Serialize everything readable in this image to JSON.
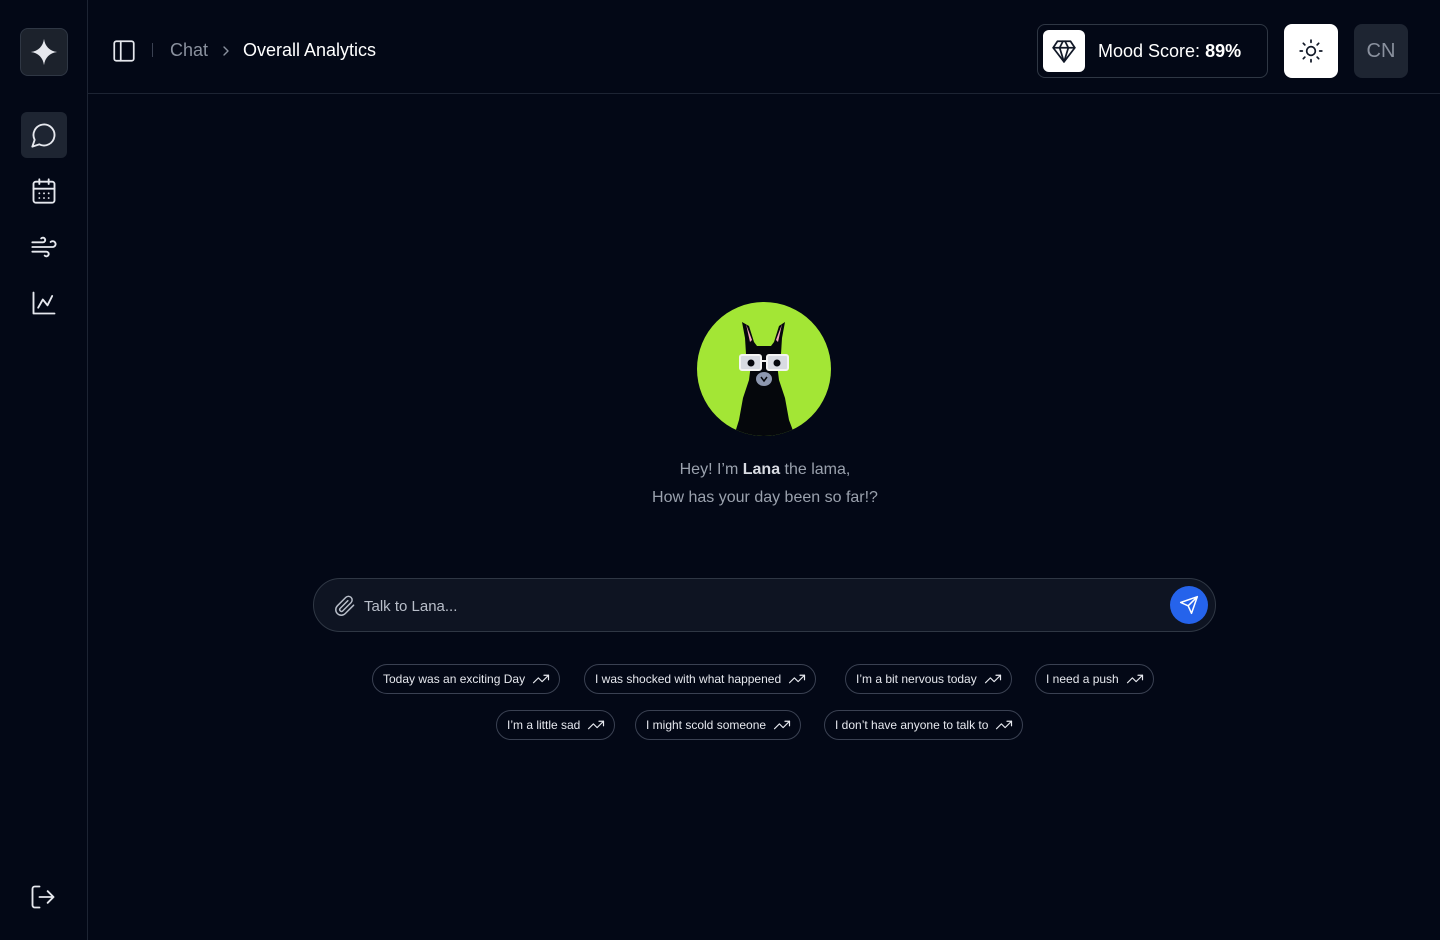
{
  "sidebar": {
    "logo_icon": "sparkle-icon",
    "nav": [
      {
        "icon": "chat-bubble-icon",
        "active": true
      },
      {
        "icon": "calendar-icon",
        "active": false
      },
      {
        "icon": "wind-icon",
        "active": false
      },
      {
        "icon": "chart-icon",
        "active": false
      }
    ],
    "logout_icon": "logout-icon"
  },
  "header": {
    "breadcrumb": {
      "parent": "Chat",
      "current": "Overall Analytics"
    },
    "mood": {
      "label": "Mood Score: ",
      "value": "89%"
    },
    "theme_icon": "sun-icon",
    "avatar": "CN"
  },
  "main": {
    "greeting": {
      "prefix": "Hey! I’m ",
      "name": "Lana",
      "suffix": " the lama,",
      "question": "How has your day been so far!?"
    },
    "input": {
      "placeholder": "Talk to Lana..."
    },
    "suggestions_row1": [
      "Today was an exciting Day",
      "I was shocked with what happened",
      "I’m a bit nervous today",
      "I need a push"
    ],
    "suggestions_row2": [
      "I’m a little sad",
      "I might scold someone",
      "I don’t have anyone to talk to"
    ]
  },
  "colors": {
    "background": "#030816",
    "mascot_bg": "#a3e635",
    "send_button": "#2563eb"
  }
}
